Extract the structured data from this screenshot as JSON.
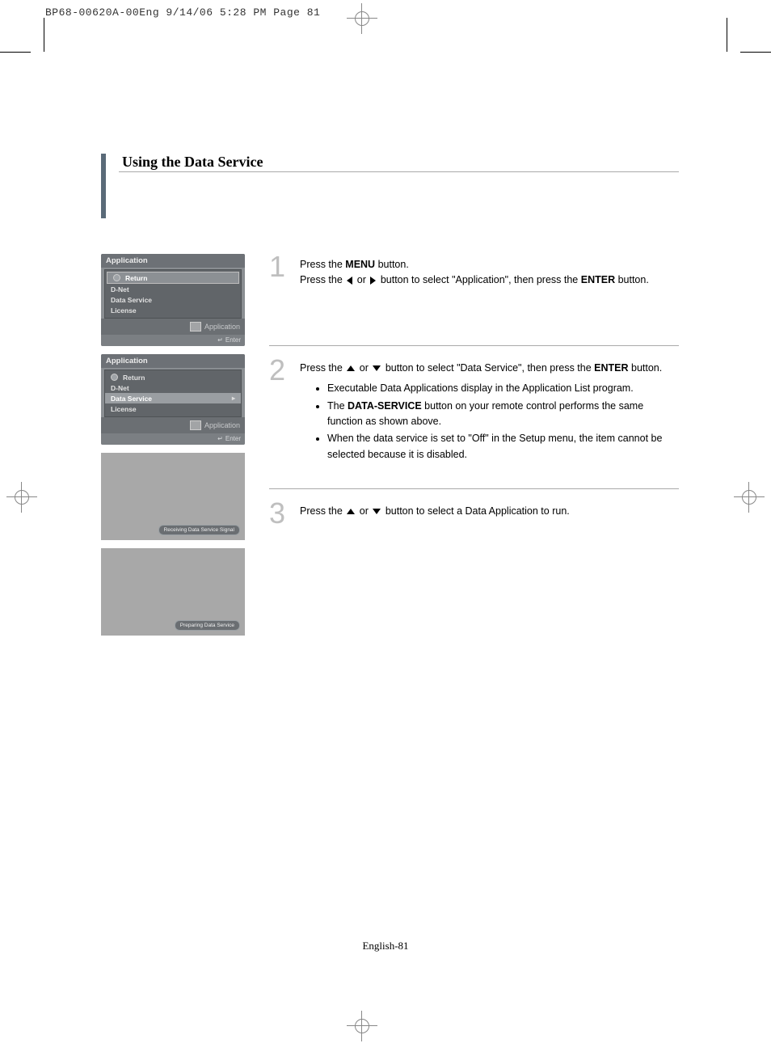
{
  "print_header": "BP68-00620A-00Eng  9/14/06  5:28 PM  Page 81",
  "page_title": "Using the Data Service",
  "osd1": {
    "title": "Application",
    "items": [
      "Return",
      "D-Net",
      "Data Service",
      "License"
    ],
    "footer_label": "Application",
    "enter_label": "Enter"
  },
  "osd2": {
    "title": "Application",
    "items": [
      "Return",
      "D-Net",
      "Data Service",
      "License"
    ],
    "footer_label": "Application",
    "enter_label": "Enter"
  },
  "screen1_banner": "Receiving Data Service Signal",
  "screen2_banner": "Preparing Data Service",
  "step1": {
    "num": "1",
    "line1_a": "Press the ",
    "line1_b": "MENU",
    "line1_c": " button.",
    "line2_a": "Press the ",
    "line2_b": " or ",
    "line2_c": " button to select \"Application\", then press the ",
    "line2_d": "ENTER",
    "line2_e": " button."
  },
  "step2": {
    "num": "2",
    "line1_a": "Press the ",
    "line1_b": " or ",
    "line1_c": " button to select \"Data Service\", then press the ",
    "line1_d": "ENTER",
    "line1_e": " button.",
    "bullet1": "Executable Data Applications display in the Application List program.",
    "bullet2_a": "The ",
    "bullet2_b": "DATA-SERVICE",
    "bullet2_c": " button on your remote control performs the same function as shown above.",
    "bullet3": "When the data service is set to \"Off\" in the Setup menu, the item cannot be selected because it is disabled."
  },
  "step3": {
    "num": "3",
    "line_a": "Press the ",
    "line_b": " or ",
    "line_c": " button to select a Data Application to run."
  },
  "footer": "English-81"
}
